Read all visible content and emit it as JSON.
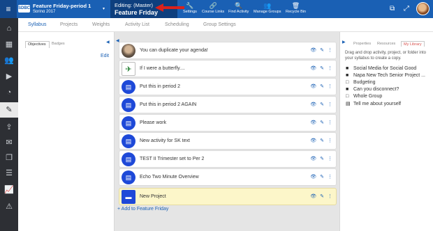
{
  "topbar": {
    "menu_icon": "hamburger-icon",
    "logo": "SDBC",
    "course_title": "Feature Friday-period 1",
    "course_term": "Spring 2017",
    "course_caret": "▾",
    "editing_label": "Editing: (Master)",
    "editing_title": "Feature Friday",
    "actions": [
      {
        "label": "Settings",
        "icon": "wrench-icon",
        "glyph": "🔧"
      },
      {
        "label": "Course Links",
        "icon": "link-icon",
        "glyph": "🔗"
      },
      {
        "label": "Find Activity",
        "icon": "search-icon",
        "glyph": "🔍"
      },
      {
        "label": "Manage Groups",
        "icon": "groups-icon",
        "glyph": "👥"
      },
      {
        "label": "Recycle Bin",
        "icon": "recycle-bin-icon",
        "glyph": "🗑"
      }
    ],
    "right_icons": [
      "copy-icon",
      "fullscreen-icon"
    ],
    "accent": "#1a60b4"
  },
  "leftnav": {
    "icons": [
      "home-icon",
      "calendar-icon",
      "people-icon",
      "play-icon",
      "dashboard-icon",
      "pencil-icon",
      "upload-icon",
      "mail-icon",
      "library-icon",
      "list-icon",
      "chart-icon",
      "warning-icon"
    ]
  },
  "tabs": [
    "Syllabus",
    "Projects",
    "Weights",
    "Activity List",
    "Scheduling",
    "Group Settings"
  ],
  "left_panel": {
    "tabs": [
      "Objectives",
      "Badges"
    ],
    "edit_label": "Edit"
  },
  "activities": [
    {
      "title": "You can duplicate your agenda!",
      "icon": "photo"
    },
    {
      "title": "If I were a butterfly....",
      "icon": "butterfly"
    },
    {
      "title": "Put this in period 2",
      "icon": "document"
    },
    {
      "title": "Put this in period 2 AGAIN",
      "icon": "document"
    },
    {
      "title": "Please work",
      "icon": "document"
    },
    {
      "title": "New activity for SK text",
      "icon": "document"
    },
    {
      "title": "TEST II Trimester set to Per 2",
      "icon": "document"
    },
    {
      "title": "Echo Two Minute Overview",
      "icon": "document"
    },
    {
      "title": "New Project",
      "icon": "folder",
      "project": true
    }
  ],
  "add_link": "+ Add to Feature Friday",
  "right_panel": {
    "tabs": [
      "Properties",
      "Resources",
      "My Library"
    ],
    "active_tab": "My Library",
    "help": "Drag and drop activity, project, or folder into your syllabus to create a copy.",
    "library": [
      {
        "label": "Social Media for Social Good",
        "icon": "folder"
      },
      {
        "label": "Napa New Tech Senior Project ...",
        "icon": "folder"
      },
      {
        "label": "Budgeting",
        "icon": "folder-empty"
      },
      {
        "label": "Can you disconnect?",
        "icon": "folder"
      },
      {
        "label": "Whole Group",
        "icon": "folder-empty"
      },
      {
        "label": "Tell me about yourself",
        "icon": "document"
      }
    ]
  }
}
